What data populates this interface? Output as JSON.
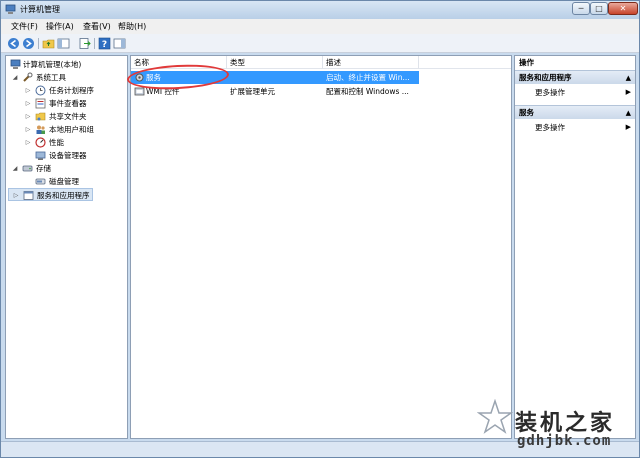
{
  "window": {
    "title": "计算机管理"
  },
  "window_controls": {
    "minimize": "─",
    "maximize": "□",
    "close": "✕"
  },
  "menu": [
    {
      "label": "文件(F)"
    },
    {
      "label": "操作(A)"
    },
    {
      "label": "查看(V)"
    },
    {
      "label": "帮助(H)"
    }
  ],
  "tree": {
    "root": "计算机管理(本地)",
    "system_tools": "系统工具",
    "task_scheduler": "任务计划程序",
    "event_viewer": "事件查看器",
    "shared_folders": "共享文件夹",
    "local_users": "本地用户和组",
    "performance": "性能",
    "device_manager": "设备管理器",
    "storage": "存储",
    "disk_management": "磁盘管理",
    "services_apps": "服务和应用程序"
  },
  "list": {
    "columns": {
      "name": "名称",
      "type": "类型",
      "desc": "描述"
    },
    "rows": [
      {
        "name": "服务",
        "type": "",
        "desc": "启动、终止并设置 Win..."
      },
      {
        "name": "WMI 控件",
        "type": "扩展管理单元",
        "desc": "配置和控制 Windows ..."
      }
    ]
  },
  "actions": {
    "title": "操作",
    "sections": [
      {
        "header": "服务和应用程序",
        "item": "更多操作"
      },
      {
        "header": "服务",
        "item": "更多操作"
      }
    ],
    "arrow": "▶"
  },
  "watermark": {
    "title": "装机之家",
    "url": "gdhjbk.com"
  },
  "colors": {
    "selection": "#3399ff",
    "highlight_circle": "#e13a3a",
    "window_frame": "#c9dbee"
  }
}
